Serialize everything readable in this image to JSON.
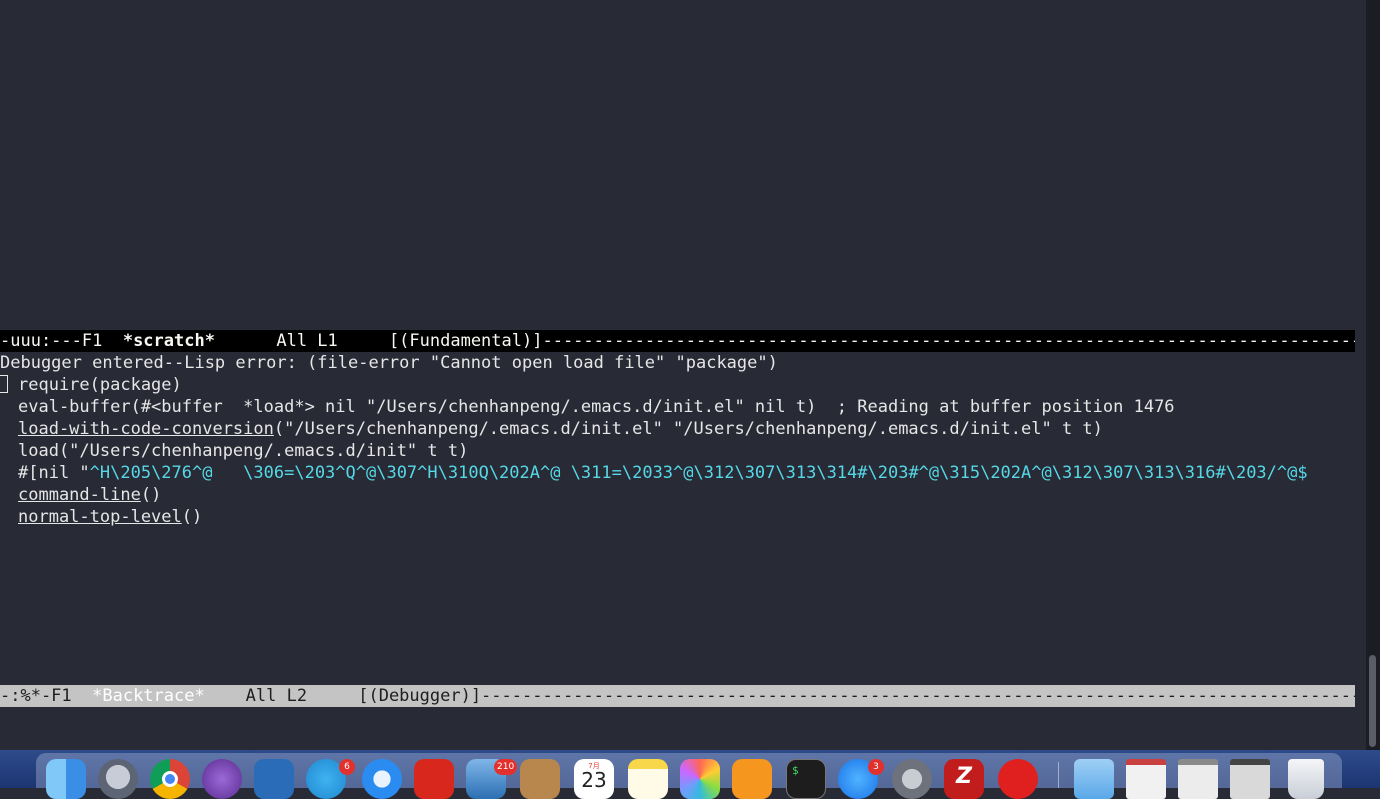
{
  "editor": {
    "scratch_modeline": {
      "prefix": "-uuu:---F1  ",
      "buffer": "*scratch*",
      "rest": "      All L1     [(Fundamental)]-----------------------------------------------------------------------------------------------------------------------------------------------------------"
    },
    "backtrace": {
      "header": "Debugger entered--Lisp error: (file-error \"Cannot open load file\" \"package\")",
      "frame_require": "require(package)",
      "frame_eval": "eval-buffer(#<buffer  *load*> nil \"/Users/chenhanpeng/.emacs.d/init.el\" nil t)  ; Reading at buffer position 1476",
      "frame_lwcc_fn": "load-with-code-conversion",
      "frame_lwcc_args": "(\"/Users/chenhanpeng/.emacs.d/init.el\" \"/Users/chenhanpeng/.emacs.d/init.el\" t t)",
      "frame_load": "load(\"/Users/chenhanpeng/.emacs.d/init\" t t)",
      "frame_bytecode_prefix": "#[nil \"",
      "frame_bytecode_data": "^H\\205\\276^@   \\306=\\203^Q^@\\307^H\\310Q\\202A^@ \\311=\\2033^@\\312\\307\\313\\314#\\203#^@\\315\\202A^@\\312\\307\\313\\316#\\203/^@$",
      "frame_cmdline_fn": "command-line",
      "frame_cmdline_args": "()",
      "frame_ntl_fn": "normal-top-level",
      "frame_ntl_args": "()"
    },
    "backtrace_modeline": {
      "prefix": "-:%*-F1  ",
      "buffer": "*Backtrace*",
      "rest": "    All L2     [(Debugger)]------------------------------------------------------------------------------------------------------------------------------------------------------------------"
    }
  },
  "dock": {
    "items": [
      {
        "name": "finder",
        "icon": "finder-icon"
      },
      {
        "name": "launchpad",
        "icon": "rocket-icon"
      },
      {
        "name": "chrome",
        "icon": "chrome-icon"
      },
      {
        "name": "emacs",
        "icon": "emacs-icon"
      },
      {
        "name": "vscode",
        "icon": "vscode-icon"
      },
      {
        "name": "telegram",
        "icon": "telegram-icon"
      },
      {
        "name": "safari",
        "icon": "safari-icon"
      },
      {
        "name": "netease-music",
        "icon": "music-icon"
      },
      {
        "name": "xcode-preview",
        "icon": "hammer-icon"
      },
      {
        "name": "contacts",
        "icon": "contacts-icon"
      },
      {
        "name": "calendar",
        "icon": "calendar-icon"
      },
      {
        "name": "notes",
        "icon": "notes-icon"
      },
      {
        "name": "photos",
        "icon": "photos-icon"
      },
      {
        "name": "books",
        "icon": "books-icon"
      },
      {
        "name": "terminal",
        "icon": "terminal-icon"
      },
      {
        "name": "app-store",
        "icon": "app-store-icon"
      },
      {
        "name": "system-preferences",
        "icon": "gear-icon"
      },
      {
        "name": "filezilla",
        "icon": "filezilla-icon"
      },
      {
        "name": "netease-cloud-music",
        "icon": "music-note-icon"
      },
      {
        "name": "downloads-folder",
        "icon": "folder-icon"
      },
      {
        "name": "window-1",
        "icon": "window-thumbnail-icon"
      },
      {
        "name": "window-2",
        "icon": "window-thumbnail-icon"
      },
      {
        "name": "window-3",
        "icon": "window-thumbnail-icon"
      },
      {
        "name": "trash",
        "icon": "trash-icon"
      }
    ],
    "badges": {
      "telegram": "6",
      "xcode_preview": "210",
      "app_store": "3"
    },
    "calendar": {
      "month": "7月",
      "day": "23"
    },
    "terminal_prompt": "$",
    "filezilla_letter": "Z"
  },
  "colors": {
    "background": "#282a36",
    "foreground": "#e6e6e6",
    "bytecode": "#56d8e6",
    "active_modeline_bg": "#000000",
    "inactive_modeline_bg": "#c4c4c4"
  }
}
